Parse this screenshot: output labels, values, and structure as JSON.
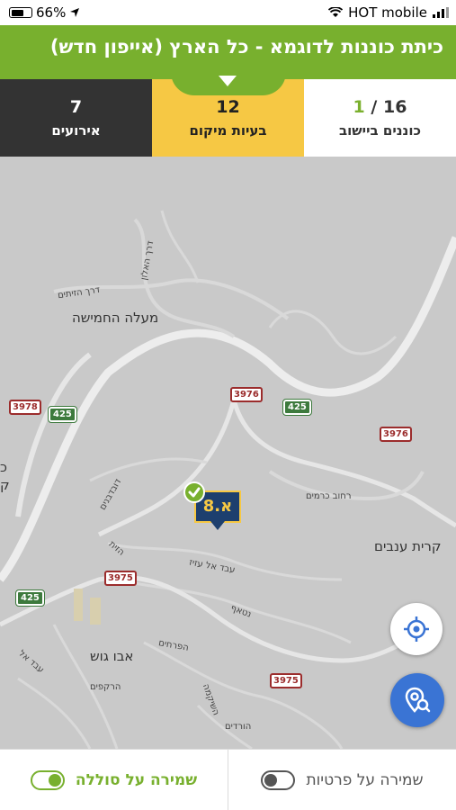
{
  "status_bar": {
    "battery": "66%",
    "carrier": "HOT mobile"
  },
  "header": {
    "title": "כיתת כוננות לדוגמא - כל הארץ (אייפון חדש)"
  },
  "stats": {
    "events": {
      "value": "7",
      "label": "אירועים"
    },
    "location_issues": {
      "value": "12",
      "label": "בעיות מיקום"
    },
    "residents": {
      "active": "1",
      "separator": "/",
      "total": "16",
      "label": "כוננים ביישוב"
    }
  },
  "map": {
    "places": {
      "maale_hahamisha": "מעלה החמישה",
      "kiryat_anavim": "קרית ענבים",
      "abu_ghosh": "אבו גוש",
      "edge_left_1": "כ",
      "edge_left_2": "ק"
    },
    "streets": {
      "derech_haalon": "דרך האלון",
      "derech_hazeitim": "דרך הזיתים",
      "rehov_kramim": "רחוב כרמים",
      "duvdevanim": "דובדבנים",
      "ein_naba": "עבד אל עזיז",
      "netaf": "נטאף",
      "haprahim": "הפרחים",
      "harkafim": "הרקפים",
      "hashikma": "השיקמה",
      "abed_el": "עבד אל",
      "hativ": "הזית",
      "vardim": "הורדים"
    },
    "road_shields": {
      "r3978": "3978",
      "r425a": "425",
      "r3976a": "3976",
      "r425b": "425",
      "r3976b": "3976",
      "r3975a": "3975",
      "r425c": "425",
      "r3975b": "3975"
    },
    "marker": {
      "label": "א.8",
      "check_icon": "check-icon"
    }
  },
  "buttons": {
    "my_location_icon": "crosshair-icon",
    "search_location_icon": "location-search-icon"
  },
  "footer": {
    "guard_on_label": "שמירה על סוללה",
    "guard_off_label": "שמירה על פרטיות"
  },
  "colors": {
    "brand_green": "#78b02e",
    "events_bg": "#333333",
    "location_bg": "#f6c844",
    "map_bg": "#c9c9c9",
    "fab_blue": "#3a74d4",
    "marker_navy": "#1d3f6e"
  }
}
